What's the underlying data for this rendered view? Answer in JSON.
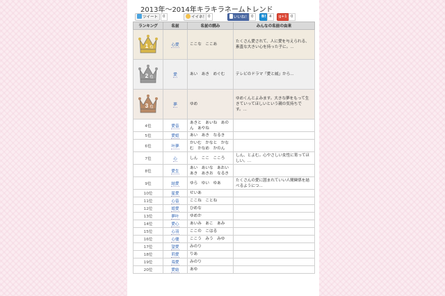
{
  "page": {
    "title": "2013年～2014年キラキラネームトレンド"
  },
  "share": {
    "tweet_label": "ツイート",
    "tweet_count": "0",
    "iine_label": "イイネ！",
    "iine_count": "0",
    "fb_like_label": "いいね！",
    "fb_count": "0",
    "hatena_count": "4",
    "gplus_label": "g+1",
    "gplus_count": "0"
  },
  "table": {
    "headers": [
      "ランキング",
      "名前",
      "名前の読み",
      "みんなの名前の由来"
    ],
    "top_rows": [
      {
        "rank": "1",
        "rank_suffix": "位",
        "name": "心愛",
        "reading": "ここな　ここあ",
        "origin": "たくさん愛されて、人に愛を与えられる、素直な大きい心を持った子に。..."
      },
      {
        "rank": "2",
        "rank_suffix": "位",
        "name": "愛",
        "reading": "あい　あき　めぐむ",
        "origin": "テレビのドラマ「愛と誠」から..."
      },
      {
        "rank": "3",
        "rank_suffix": "位",
        "name": "夢",
        "reading": "ゆめ",
        "origin": "ゆめくんとよみます。大きな夢をもって生きていってほしいという親の気持ちです。..."
      }
    ],
    "rows": [
      {
        "rank": "4位",
        "name": "愛音",
        "reading": "あきと　あいね　あのん　あやね",
        "origin": ""
      },
      {
        "rank": "5位",
        "name": "愛姫",
        "reading": "あい　あき　なるき",
        "origin": ""
      },
      {
        "rank": "6位",
        "name": "叶夢",
        "reading": "かいむ　かなと　かなむ　かなめ　かのん",
        "origin": ""
      },
      {
        "rank": "7位",
        "name": "心",
        "reading": "しん　ここ　こころ",
        "origin": "しん、とよむ。心やさしい女性に育ってほしい。..."
      },
      {
        "rank": "8位",
        "name": "愛生",
        "reading": "あい　あいな　あおい　あき　あきお　なるき",
        "origin": ""
      },
      {
        "rank": "9位",
        "name": "結愛",
        "reading": "ゆら　ゆい　ゆあ",
        "origin": "たくさんの愛に囲まれていい人間関係を結べるようにつ..."
      },
      {
        "rank": "10位",
        "name": "星愛",
        "reading": "せいあ",
        "origin": ""
      },
      {
        "rank": "11位",
        "name": "心音",
        "reading": "ここね　ことね",
        "origin": ""
      },
      {
        "rank": "12位",
        "name": "姫愛",
        "reading": "ひめな",
        "origin": ""
      },
      {
        "rank": "13位",
        "name": "夢叶",
        "reading": "ゆめか",
        "origin": ""
      },
      {
        "rank": "14位",
        "name": "愛心",
        "reading": "あいみ　あこ　あみ",
        "origin": ""
      },
      {
        "rank": "15位",
        "name": "心羽",
        "reading": "ここの　こはる",
        "origin": ""
      },
      {
        "rank": "16位",
        "name": "心優",
        "reading": "ここう　みう　みゆ",
        "origin": ""
      },
      {
        "rank": "17位",
        "name": "望愛",
        "reading": "みのり",
        "origin": ""
      },
      {
        "rank": "18位",
        "name": "莉愛",
        "reading": "りあ",
        "origin": ""
      },
      {
        "rank": "19位",
        "name": "海愛",
        "reading": "みのり",
        "origin": ""
      },
      {
        "rank": "20位",
        "name": "愛結",
        "reading": "あゆ",
        "origin": ""
      }
    ]
  },
  "colors": {
    "gold": "#d8b64a",
    "silver": "#9a9a9a",
    "bronze": "#b98a67",
    "link": "#3a6bb8"
  }
}
